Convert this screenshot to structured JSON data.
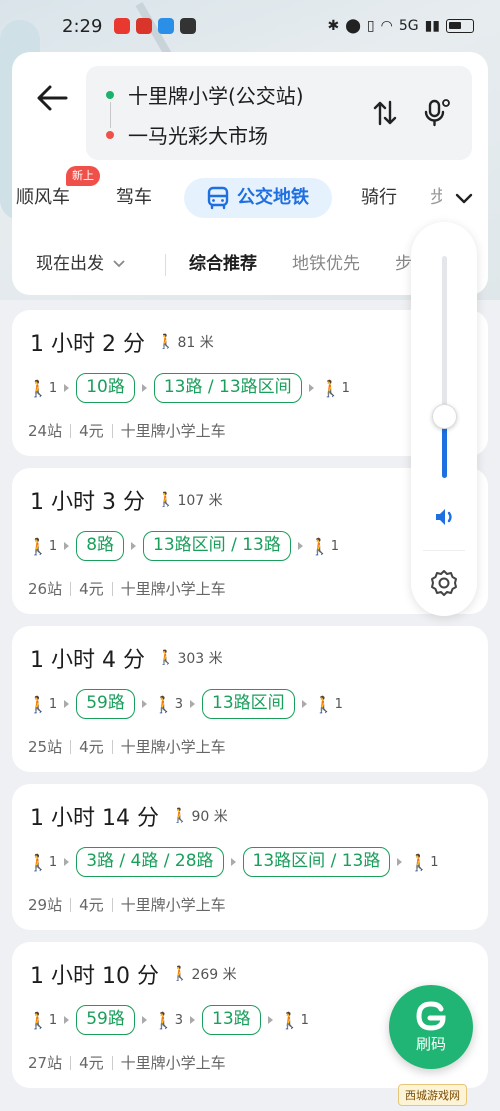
{
  "status_bar": {
    "time": "2:29",
    "network": "5G"
  },
  "route": {
    "from": "十里牌小学(公交站)",
    "to": "一马光彩大市场"
  },
  "modes": [
    {
      "label": "顺风车",
      "badge": "新上"
    },
    {
      "label": "驾车"
    },
    {
      "label": "公交地铁",
      "active": true
    },
    {
      "label": "骑行"
    },
    {
      "label": "步行"
    }
  ],
  "filters": {
    "depart": "现在出发",
    "sort_options": [
      "综合推荐",
      "地铁优先",
      "步行少"
    ],
    "selected": "综合推荐"
  },
  "routes": [
    {
      "duration": "1 小时 2 分",
      "walk_distance": "81 米",
      "legs": [
        {
          "type": "walk",
          "count": "1"
        },
        {
          "type": "bus",
          "name": "10路"
        },
        {
          "type": "bus",
          "name": "13路 / 13路区间"
        },
        {
          "type": "walk",
          "count": "1"
        }
      ],
      "stops": "24站",
      "fare": "4元",
      "board": "十里牌小学上车"
    },
    {
      "duration": "1 小时 3 分",
      "walk_distance": "107 米",
      "legs": [
        {
          "type": "walk",
          "count": "1"
        },
        {
          "type": "bus",
          "name": "8路"
        },
        {
          "type": "bus",
          "name": "13路区间 / 13路"
        },
        {
          "type": "walk",
          "count": "1"
        }
      ],
      "stops": "26站",
      "fare": "4元",
      "board": "十里牌小学上车"
    },
    {
      "duration": "1 小时 4 分",
      "walk_distance": "303 米",
      "legs": [
        {
          "type": "walk",
          "count": "1"
        },
        {
          "type": "bus",
          "name": "59路"
        },
        {
          "type": "walk",
          "count": "3"
        },
        {
          "type": "bus",
          "name": "13路区间"
        },
        {
          "type": "walk",
          "count": "1"
        }
      ],
      "stops": "25站",
      "fare": "4元",
      "board": "十里牌小学上车"
    },
    {
      "duration": "1 小时 14 分",
      "walk_distance": "90 米",
      "legs": [
        {
          "type": "walk",
          "count": "1"
        },
        {
          "type": "bus",
          "name": "3路 / 4路 / 28路"
        },
        {
          "type": "bus",
          "name": "13路区间 / 13路"
        },
        {
          "type": "walk",
          "count": "1"
        }
      ],
      "stops": "29站",
      "fare": "4元",
      "board": "十里牌小学上车"
    },
    {
      "duration": "1 小时 10 分",
      "walk_distance": "269 米",
      "legs": [
        {
          "type": "walk",
          "count": "1"
        },
        {
          "type": "bus",
          "name": "59路"
        },
        {
          "type": "walk",
          "count": "3"
        },
        {
          "type": "bus",
          "name": "13路"
        },
        {
          "type": "walk",
          "count": "1"
        }
      ],
      "stops": "27站",
      "fare": "4元",
      "board": "十里牌小学上车"
    }
  ],
  "volume": {
    "level": 0.28
  },
  "scan_button": {
    "label": "刷码"
  },
  "watermark": "西城游戏网",
  "colors": {
    "accent_blue": "#1e6fe0",
    "transit_green": "#1a9f5b",
    "fab_green": "#20b574",
    "origin_dot": "#1bb36b",
    "destination_dot": "#f0504a"
  }
}
